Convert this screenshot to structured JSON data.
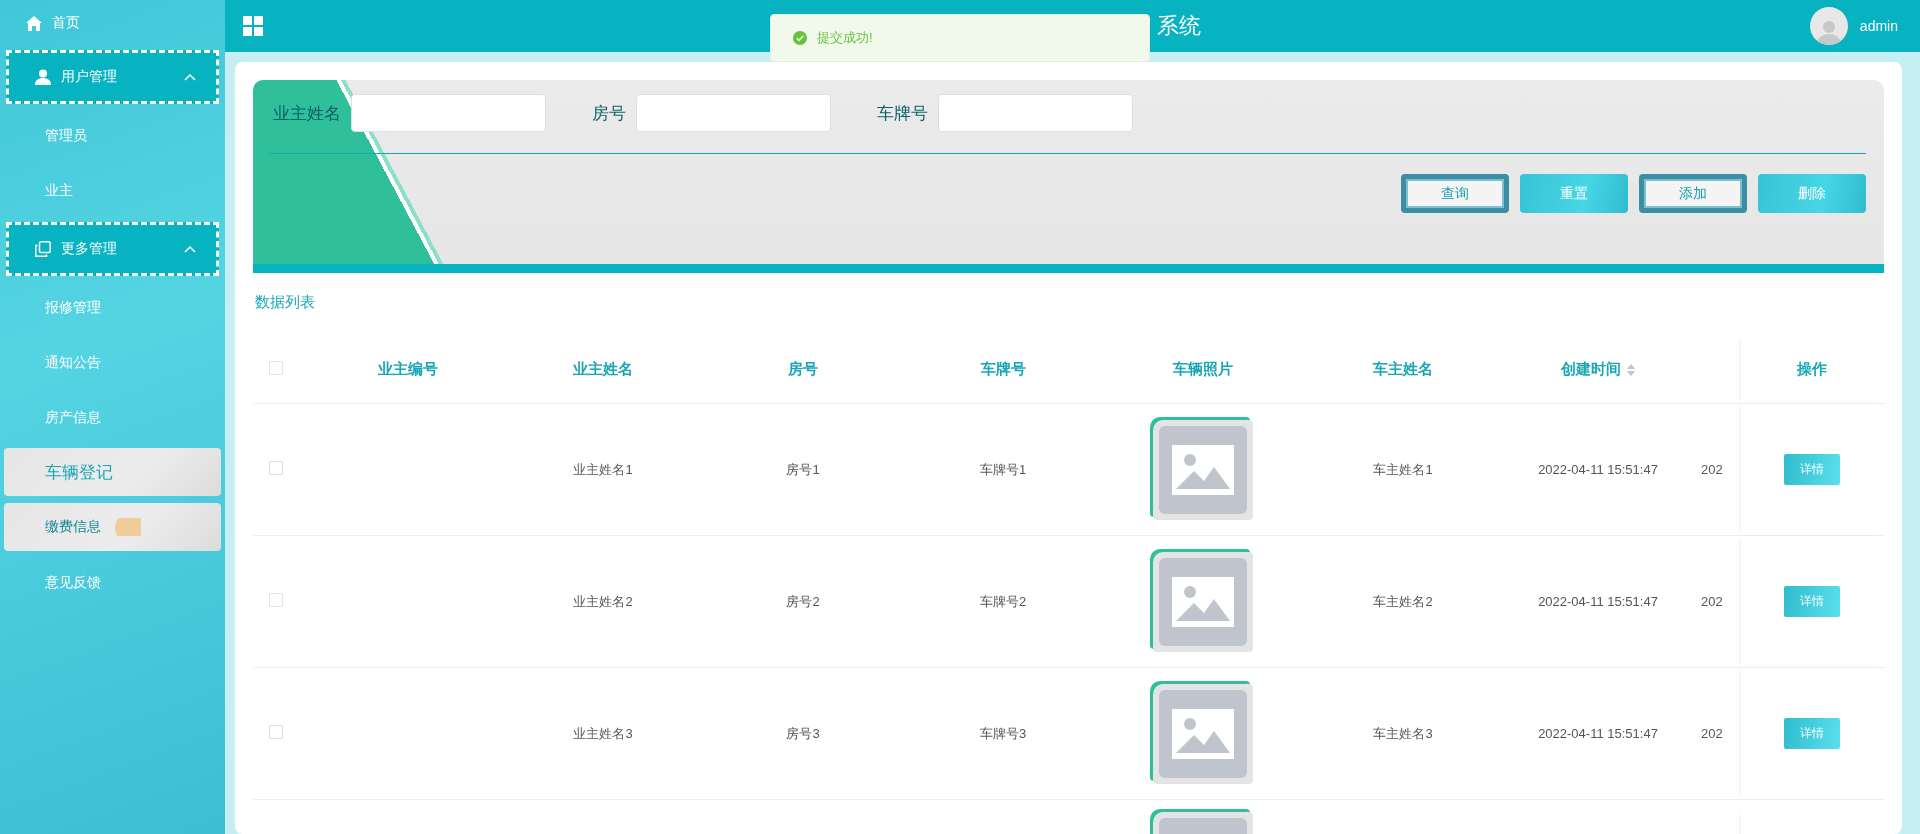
{
  "sidebar": {
    "home": {
      "label": "首页"
    },
    "groups": [
      {
        "label": "用户管理",
        "expanded": true,
        "children": [
          {
            "label": "管理员",
            "selected": false,
            "hovered": false
          },
          {
            "label": "业主",
            "selected": false,
            "hovered": false
          }
        ]
      },
      {
        "label": "更多管理",
        "expanded": true,
        "children": [
          {
            "label": "报修管理",
            "selected": false,
            "hovered": false
          },
          {
            "label": "通知公告",
            "selected": false,
            "hovered": false
          },
          {
            "label": "房产信息",
            "selected": false,
            "hovered": false
          },
          {
            "label": "车辆登记",
            "selected": true,
            "hovered": false
          },
          {
            "label": "缴费信息",
            "selected": false,
            "hovered": true
          },
          {
            "label": "意见反馈",
            "selected": false,
            "hovered": false
          }
        ]
      }
    ]
  },
  "header": {
    "title": "系统",
    "user": "admin"
  },
  "toast": {
    "message": "提交成功!"
  },
  "search": {
    "fields": [
      {
        "label": "业主姓名"
      },
      {
        "label": "房号"
      },
      {
        "label": "车牌号"
      }
    ],
    "buttons": [
      {
        "label": "查询",
        "kind": "outline"
      },
      {
        "label": "重置",
        "kind": "filled"
      },
      {
        "label": "添加",
        "kind": "outline"
      },
      {
        "label": "删除",
        "kind": "filled"
      }
    ]
  },
  "list_title": "数据列表",
  "table": {
    "header_checked": false,
    "columns": [
      "业主编号",
      "业主姓名",
      "房号",
      "车牌号",
      "车辆照片",
      "车主姓名",
      "创建时间"
    ],
    "action_column": "操作",
    "rows": [
      {
        "kind": "full",
        "checked": false,
        "cells": [
          "业主姓名1",
          "房号1",
          "车牌号1",
          "车主姓名1",
          "2022-04-11 15:51:47",
          "202"
        ],
        "action": "详情"
      },
      {
        "kind": "full",
        "checked": false,
        "cells": [
          "业主姓名2",
          "房号2",
          "车牌号2",
          "车主姓名2",
          "2022-04-11 15:51:47",
          "202"
        ],
        "action": "详情"
      },
      {
        "kind": "full",
        "checked": false,
        "cells": [
          "业主姓名3",
          "房号3",
          "车牌号3",
          "车主姓名3",
          "2022-04-11 15:51:47",
          "202"
        ],
        "action": "详情"
      },
      {
        "kind": "partial"
      }
    ]
  }
}
